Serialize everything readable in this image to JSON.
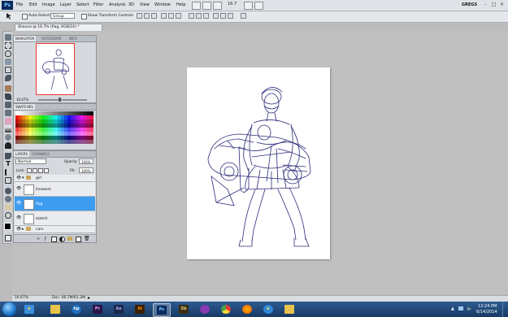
{
  "menubar": {
    "logo": "Ps",
    "items": [
      "File",
      "Edit",
      "Image",
      "Layer",
      "Select",
      "Filter",
      "Analysis",
      "3D",
      "View",
      "Window",
      "Help"
    ],
    "zoom": "16.7",
    "workspace": "GREGS",
    "window_buttons": [
      "-",
      "□",
      "×"
    ]
  },
  "options": {
    "auto_select": "Auto-Select:",
    "group_value": "Group",
    "show_transform": "Show Transform Controls"
  },
  "document": {
    "tab_title": "Shauna @ 16.7% (flag, RGB/16) *",
    "zoom_status": "16.67%",
    "doc_size": "Doc: 46.7M/61.2M"
  },
  "navigator": {
    "tabs": [
      "NAVIGATOR",
      "HISTOGRAM",
      "INFO"
    ],
    "zoom": "16.67%"
  },
  "swatches": {
    "title": "SWATCHES"
  },
  "layers": {
    "tabs": [
      "LAYERS",
      "CHANNELS"
    ],
    "blend_mode": "Normal",
    "opacity_label": "Opacity:",
    "opacity": "100%",
    "lock_label": "Lock:",
    "fill_label": "Fill:",
    "fill": "100%",
    "items": [
      {
        "name": "girl",
        "type": "group"
      },
      {
        "name": "linework",
        "type": "layer"
      },
      {
        "name": "flag",
        "type": "layer",
        "selected": true
      },
      {
        "name": "sketch",
        "type": "layer"
      },
      {
        "name": "cars",
        "type": "group"
      }
    ]
  },
  "taskbar": {
    "apps": [
      "ie",
      "hp",
      "Pr",
      "Ae",
      "Ai",
      "Ps",
      "Sb",
      "media",
      "chrome",
      "firefox",
      "ie2",
      "folder"
    ],
    "time": "12:24 PM",
    "date": "6/14/2014"
  },
  "colors": {
    "selection": "#3d9cf0",
    "sketch_line": "#2b2b7a",
    "taskbar": "#1f4a7c"
  }
}
